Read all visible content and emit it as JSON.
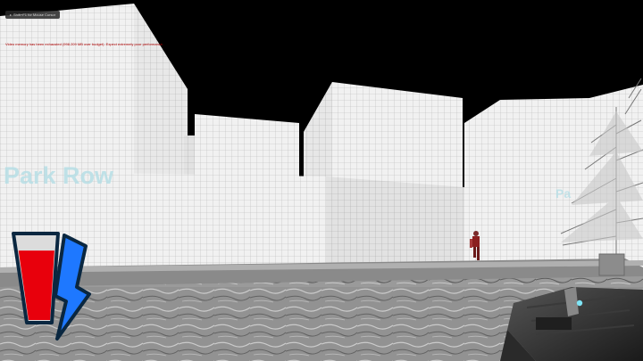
{
  "hint": {
    "label": "Shift+F1 for Mouse Cursor"
  },
  "warning": {
    "text": "Video memory has been exhausted (998.209 MB over budget). Expect extremely poor performance."
  },
  "signs": {
    "left": "Park Row",
    "right": "Pa"
  },
  "hud": {
    "health_icon": "health-glass-icon",
    "energy_icon": "lightning-bolt-icon",
    "health_level": 0.82,
    "health_color": "#e8000c",
    "energy_color": "#1e78ff"
  }
}
